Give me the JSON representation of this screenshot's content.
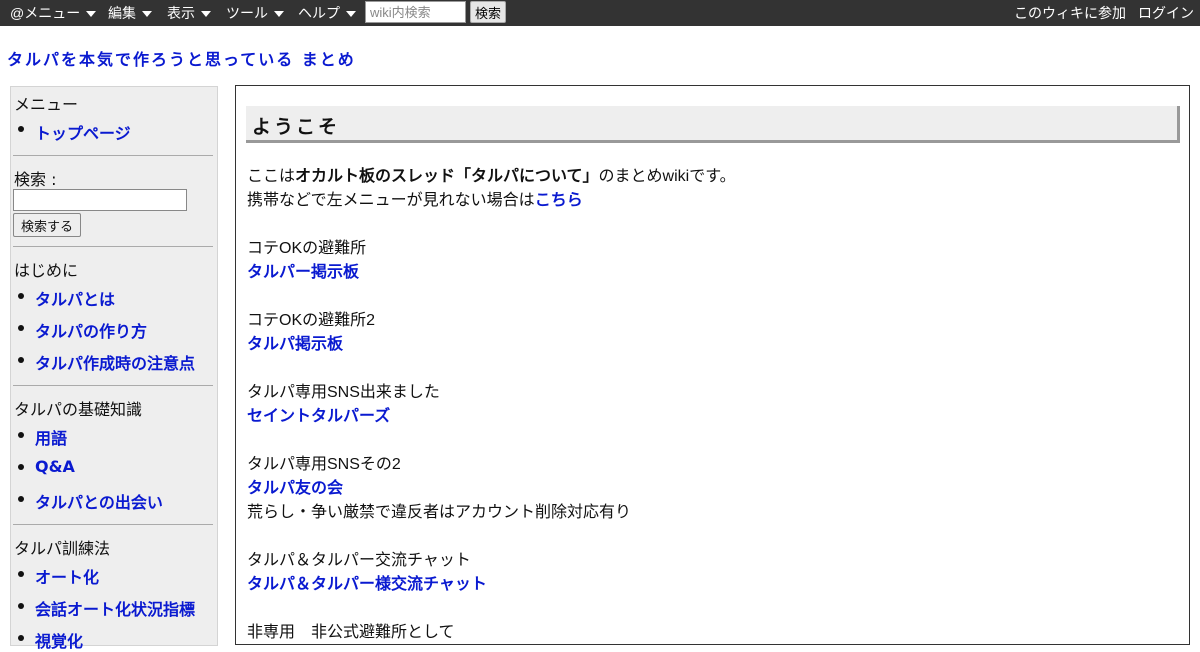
{
  "topbar": {
    "menu": "@メニュー",
    "edit": "編集",
    "view": "表示",
    "tools": "ツール",
    "help": "ヘルプ",
    "search_placeholder": "wiki内検索",
    "search_button": "検索",
    "join": "このウィキに参加",
    "login": "ログイン"
  },
  "site_title": "タルパを本気で作ろうと思っている まとめ",
  "sidebar": {
    "menu_heading": "メニュー",
    "top_page": "トップページ",
    "search_label": "検索 :",
    "search_button": "検索する",
    "intro_heading": "はじめに",
    "intro_items": [
      "タルパとは",
      "タルパの作り方",
      "タルパ作成時の注意点"
    ],
    "basics_heading": "タルパの基礎知識",
    "basics_items": [
      "用語",
      "Q&A",
      "タルパとの出会い"
    ],
    "training_heading": "タルパ訓練法",
    "training_items": [
      "オート化",
      "会話オート化状況指標",
      "視覚化"
    ]
  },
  "main": {
    "heading": "ようこそ",
    "intro_pre": "ここは",
    "intro_bold": "オカルト板のスレッド「タルパについて」",
    "intro_post": "のまとめwikiです。",
    "mobile_pre": "携帯などで左メニューが見れない場合は",
    "mobile_link": "こちら",
    "blocks": [
      {
        "text": "コテOKの避難所",
        "link": "タルパー掲示板"
      },
      {
        "text": "コテOKの避難所2",
        "link": "タルパ掲示板"
      },
      {
        "text": "タルパ専用SNS出来ました",
        "link": "セイントタルパーズ"
      },
      {
        "text": "タルパ専用SNSその2",
        "link": "タルパ友の会",
        "note": "荒らし・争い厳禁で違反者はアカウント削除対応有り"
      },
      {
        "text": "タルパ＆タルパー交流チャット",
        "link": "タルパ＆タルパー様交流チャット"
      }
    ],
    "tail": "非専用　非公式避難所として"
  }
}
